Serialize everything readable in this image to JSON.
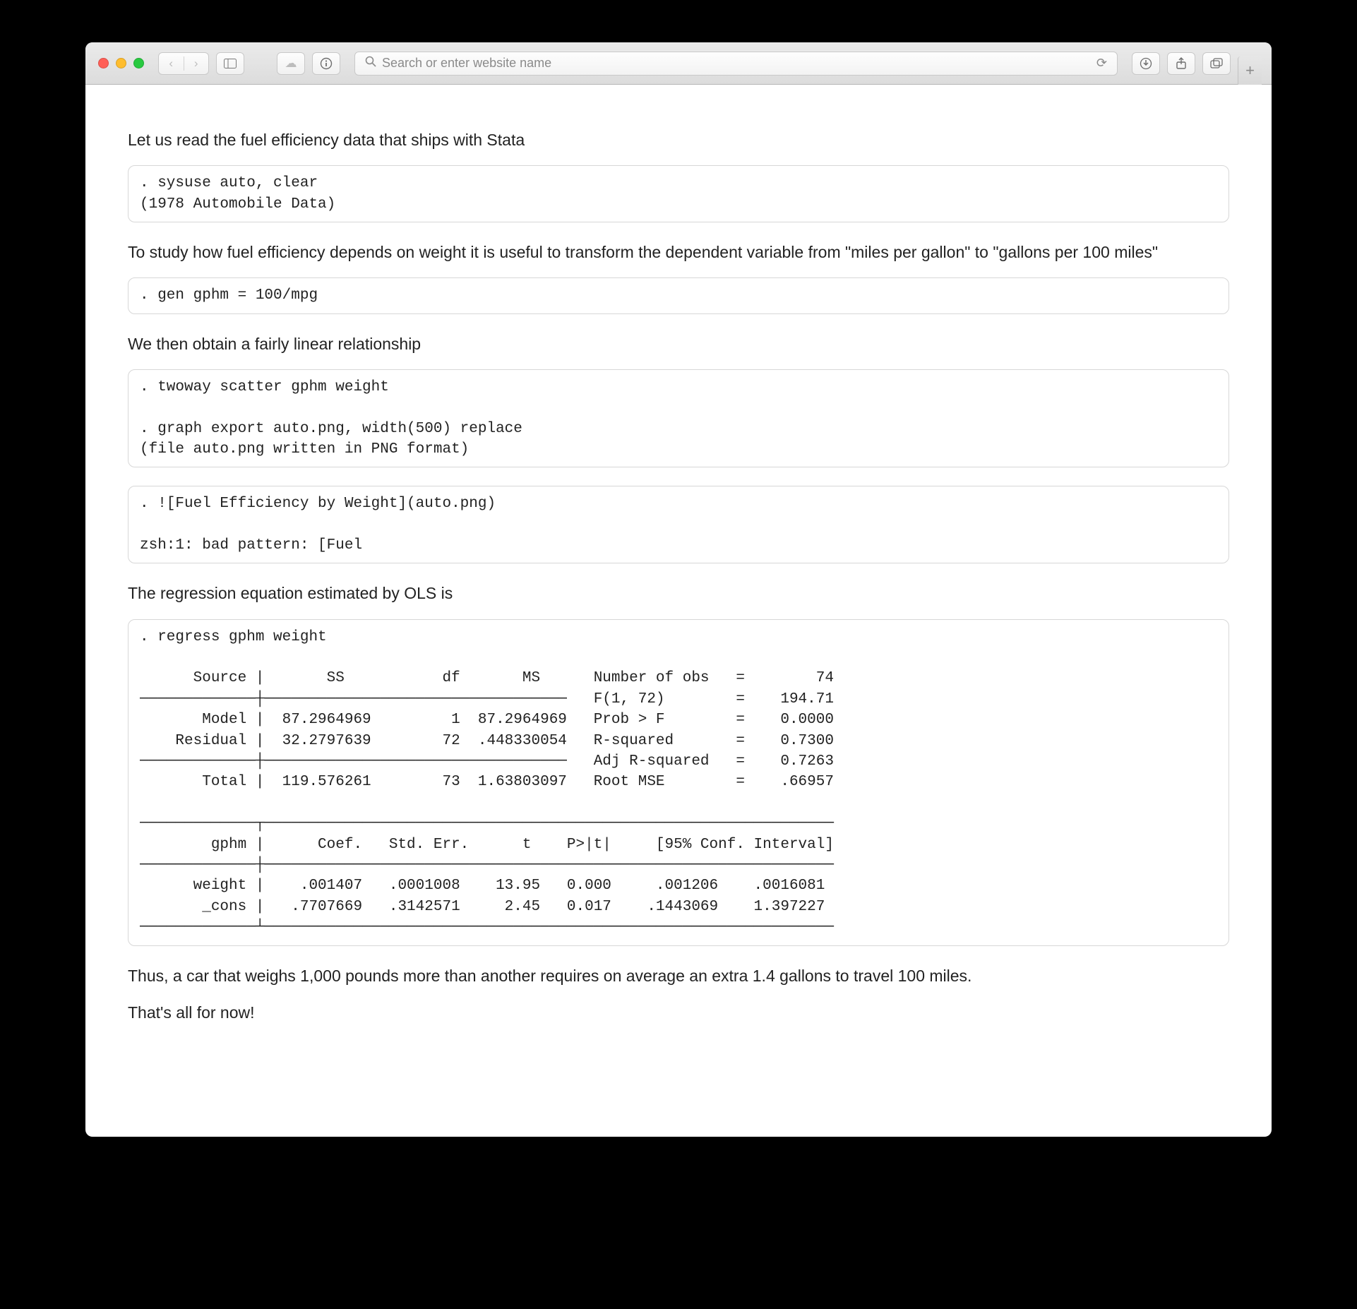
{
  "toolbar": {
    "search_placeholder": "Search or enter website name",
    "new_tab": "+"
  },
  "body": {
    "p1": "Let us read the fuel efficiency data that ships with Stata",
    "code1": ". sysuse auto, clear\n(1978 Automobile Data)",
    "p2": "To study how fuel efficiency depends on weight it is useful to transform the dependent variable from \"miles per gallon\" to \"gallons per 100 miles\"",
    "code2": ". gen gphm = 100/mpg",
    "p3": "We then obtain a fairly linear relationship",
    "code3": ". twoway scatter gphm weight\n\n. graph export auto.png, width(500) replace\n(file auto.png written in PNG format)",
    "code4": ". ![Fuel Efficiency by Weight](auto.png)\n\nzsh:1: bad pattern: [Fuel",
    "p4": "The regression equation estimated by OLS is",
    "code5": ". regress gphm weight\n\n      Source |       SS           df       MS      Number of obs   =        74\n─────────────┼──────────────────────────────────   F(1, 72)        =    194.71\n       Model |  87.2964969         1  87.2964969   Prob > F        =    0.0000\n    Residual |  32.2797639        72  .448330054   R-squared       =    0.7300\n─────────────┼──────────────────────────────────   Adj R-squared   =    0.7263\n       Total |  119.576261        73  1.63803097   Root MSE        =    .66957\n\n─────────────┬────────────────────────────────────────────────────────────────\n        gphm |      Coef.   Std. Err.      t    P>|t|     [95% Conf. Interval]\n─────────────┼────────────────────────────────────────────────────────────────\n      weight |    .001407   .0001008    13.95   0.000     .001206    .0016081\n       _cons |   .7707669   .3142571     2.45   0.017    .1443069    1.397227\n─────────────┴────────────────────────────────────────────────────────────────",
    "p5": "Thus, a car that weighs 1,000 pounds more than another requires on average an extra 1.4 gallons to travel 100 miles.",
    "p6": "That's all for now!"
  }
}
